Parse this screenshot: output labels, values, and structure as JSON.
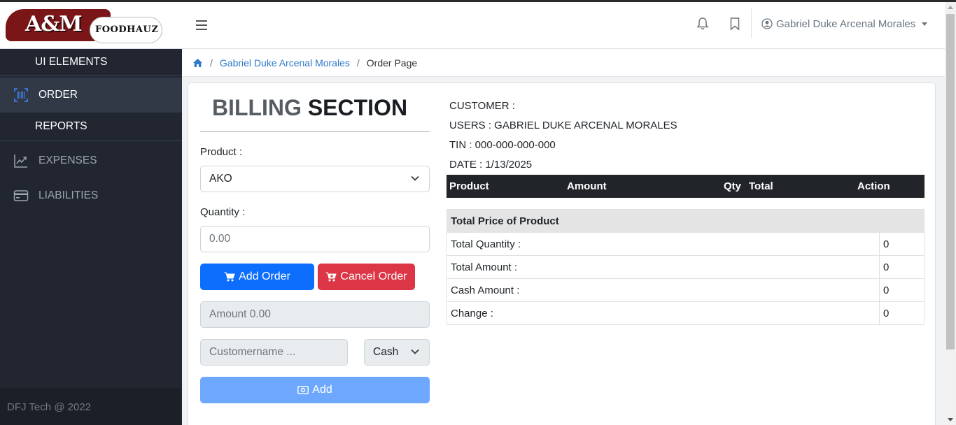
{
  "brand": {
    "main": "A&M",
    "sub": "FOODHAUZ"
  },
  "header": {
    "user_name": "Gabriel Duke Arcenal Morales"
  },
  "sidebar": {
    "items": [
      {
        "label": "UI ELEMENTS"
      },
      {
        "label": "ORDER"
      },
      {
        "label": "REPORTS"
      },
      {
        "label": "EXPENSES"
      },
      {
        "label": "LIABILITIES"
      }
    ],
    "footer": "DFJ Tech @ 2022"
  },
  "breadcrumb": {
    "link": "Gabriel Duke Arcenal Morales",
    "current": "Order Page",
    "separator": "/"
  },
  "billing": {
    "title_part1": "BILLING",
    "title_part2": "SECTION",
    "product_label": "Product :",
    "product_value": "AKO",
    "quantity_label": "Quantity :",
    "quantity_placeholder": "0.00",
    "add_order": "Add Order",
    "cancel_order": "Cancel Order",
    "amount_placeholder": "Amount 0.00",
    "customer_placeholder": "Customername ...",
    "payment_value": "Cash",
    "add_button": "Add"
  },
  "info": {
    "customer": "CUSTOMER :",
    "users": "USERS : GABRIEL DUKE ARCENAL MORALES",
    "tin": "TIN : 000-000-000-000",
    "date": "DATE : 1/13/2025"
  },
  "order_table": {
    "columns": [
      "Product",
      "Amount",
      "Qty",
      "Total",
      "Action"
    ]
  },
  "summary": {
    "title": "Total Price of Product",
    "rows": [
      {
        "label": "Total Quantity :",
        "value": "0"
      },
      {
        "label": "Total Amount :",
        "value": "0"
      },
      {
        "label": "Cash Amount :",
        "value": "0"
      },
      {
        "label": "Change :",
        "value": "0"
      }
    ]
  },
  "colors": {
    "primary": "#0d6efd",
    "danger": "#dc3545",
    "sidebar": "#212631",
    "brand_red": "#7a1618"
  }
}
